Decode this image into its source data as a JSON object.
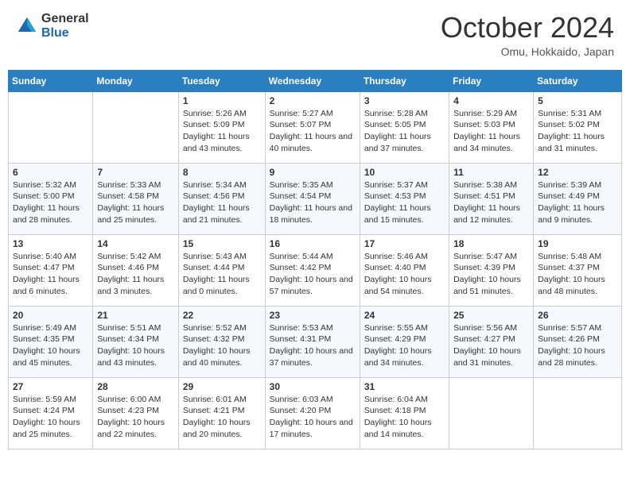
{
  "header": {
    "logo_general": "General",
    "logo_blue": "Blue",
    "month_title": "October 2024",
    "location": "Omu, Hokkaido, Japan"
  },
  "weekdays": [
    "Sunday",
    "Monday",
    "Tuesday",
    "Wednesday",
    "Thursday",
    "Friday",
    "Saturday"
  ],
  "weeks": [
    [
      {
        "day": null
      },
      {
        "day": null
      },
      {
        "day": "1",
        "sunrise": "5:26 AM",
        "sunset": "5:09 PM",
        "daylight": "11 hours and 43 minutes."
      },
      {
        "day": "2",
        "sunrise": "5:27 AM",
        "sunset": "5:07 PM",
        "daylight": "11 hours and 40 minutes."
      },
      {
        "day": "3",
        "sunrise": "5:28 AM",
        "sunset": "5:05 PM",
        "daylight": "11 hours and 37 minutes."
      },
      {
        "day": "4",
        "sunrise": "5:29 AM",
        "sunset": "5:03 PM",
        "daylight": "11 hours and 34 minutes."
      },
      {
        "day": "5",
        "sunrise": "5:31 AM",
        "sunset": "5:02 PM",
        "daylight": "11 hours and 31 minutes."
      }
    ],
    [
      {
        "day": "6",
        "sunrise": "5:32 AM",
        "sunset": "5:00 PM",
        "daylight": "11 hours and 28 minutes."
      },
      {
        "day": "7",
        "sunrise": "5:33 AM",
        "sunset": "4:58 PM",
        "daylight": "11 hours and 25 minutes."
      },
      {
        "day": "8",
        "sunrise": "5:34 AM",
        "sunset": "4:56 PM",
        "daylight": "11 hours and 21 minutes."
      },
      {
        "day": "9",
        "sunrise": "5:35 AM",
        "sunset": "4:54 PM",
        "daylight": "11 hours and 18 minutes."
      },
      {
        "day": "10",
        "sunrise": "5:37 AM",
        "sunset": "4:53 PM",
        "daylight": "11 hours and 15 minutes."
      },
      {
        "day": "11",
        "sunrise": "5:38 AM",
        "sunset": "4:51 PM",
        "daylight": "11 hours and 12 minutes."
      },
      {
        "day": "12",
        "sunrise": "5:39 AM",
        "sunset": "4:49 PM",
        "daylight": "11 hours and 9 minutes."
      }
    ],
    [
      {
        "day": "13",
        "sunrise": "5:40 AM",
        "sunset": "4:47 PM",
        "daylight": "11 hours and 6 minutes."
      },
      {
        "day": "14",
        "sunrise": "5:42 AM",
        "sunset": "4:46 PM",
        "daylight": "11 hours and 3 minutes."
      },
      {
        "day": "15",
        "sunrise": "5:43 AM",
        "sunset": "4:44 PM",
        "daylight": "11 hours and 0 minutes."
      },
      {
        "day": "16",
        "sunrise": "5:44 AM",
        "sunset": "4:42 PM",
        "daylight": "10 hours and 57 minutes."
      },
      {
        "day": "17",
        "sunrise": "5:46 AM",
        "sunset": "4:40 PM",
        "daylight": "10 hours and 54 minutes."
      },
      {
        "day": "18",
        "sunrise": "5:47 AM",
        "sunset": "4:39 PM",
        "daylight": "10 hours and 51 minutes."
      },
      {
        "day": "19",
        "sunrise": "5:48 AM",
        "sunset": "4:37 PM",
        "daylight": "10 hours and 48 minutes."
      }
    ],
    [
      {
        "day": "20",
        "sunrise": "5:49 AM",
        "sunset": "4:35 PM",
        "daylight": "10 hours and 45 minutes."
      },
      {
        "day": "21",
        "sunrise": "5:51 AM",
        "sunset": "4:34 PM",
        "daylight": "10 hours and 43 minutes."
      },
      {
        "day": "22",
        "sunrise": "5:52 AM",
        "sunset": "4:32 PM",
        "daylight": "10 hours and 40 minutes."
      },
      {
        "day": "23",
        "sunrise": "5:53 AM",
        "sunset": "4:31 PM",
        "daylight": "10 hours and 37 minutes."
      },
      {
        "day": "24",
        "sunrise": "5:55 AM",
        "sunset": "4:29 PM",
        "daylight": "10 hours and 34 minutes."
      },
      {
        "day": "25",
        "sunrise": "5:56 AM",
        "sunset": "4:27 PM",
        "daylight": "10 hours and 31 minutes."
      },
      {
        "day": "26",
        "sunrise": "5:57 AM",
        "sunset": "4:26 PM",
        "daylight": "10 hours and 28 minutes."
      }
    ],
    [
      {
        "day": "27",
        "sunrise": "5:59 AM",
        "sunset": "4:24 PM",
        "daylight": "10 hours and 25 minutes."
      },
      {
        "day": "28",
        "sunrise": "6:00 AM",
        "sunset": "4:23 PM",
        "daylight": "10 hours and 22 minutes."
      },
      {
        "day": "29",
        "sunrise": "6:01 AM",
        "sunset": "4:21 PM",
        "daylight": "10 hours and 20 minutes."
      },
      {
        "day": "30",
        "sunrise": "6:03 AM",
        "sunset": "4:20 PM",
        "daylight": "10 hours and 17 minutes."
      },
      {
        "day": "31",
        "sunrise": "6:04 AM",
        "sunset": "4:18 PM",
        "daylight": "10 hours and 14 minutes."
      },
      {
        "day": null
      },
      {
        "day": null
      }
    ]
  ],
  "labels": {
    "sunrise": "Sunrise:",
    "sunset": "Sunset:",
    "daylight": "Daylight:"
  }
}
